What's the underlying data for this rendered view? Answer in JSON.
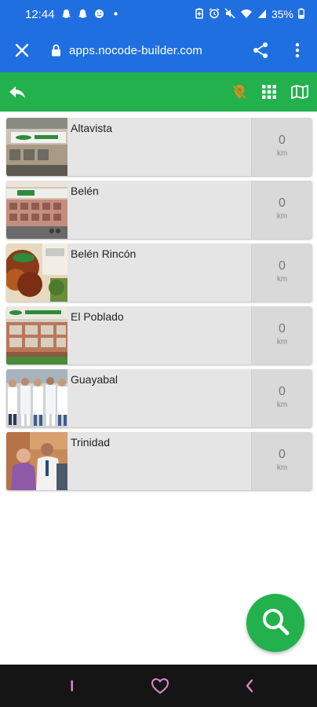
{
  "status_bar": {
    "time": "12:44",
    "battery": "35%",
    "left_icons": [
      "snapchat-icon",
      "snapchat-icon",
      "smiley-icon",
      "dot-icon"
    ],
    "right_icons": [
      "battery-saver-icon",
      "alarm-icon",
      "mute-icon",
      "wifi-icon",
      "signal-icon",
      "battery-icon"
    ]
  },
  "browser": {
    "url": "apps.nocode-builder.com",
    "close_icon": "close-icon",
    "lock_icon": "lock-icon",
    "share_icon": "share-icon",
    "menu_icon": "more-vertical-icon"
  },
  "toolbar": {
    "back_icon": "reply-icon",
    "location_off_icon": "location-off-icon",
    "grid_icon": "grid-icon",
    "map_icon": "map-icon"
  },
  "locations": [
    {
      "name": "Altavista",
      "distance": "0",
      "unit": "km"
    },
    {
      "name": "Belén",
      "distance": "0",
      "unit": "km"
    },
    {
      "name": "Belén Rincón",
      "distance": "0",
      "unit": "km"
    },
    {
      "name": "El Poblado",
      "distance": "0",
      "unit": "km"
    },
    {
      "name": "Guayabal",
      "distance": "0",
      "unit": "km"
    },
    {
      "name": "Trinidad",
      "distance": "0",
      "unit": "km"
    }
  ],
  "fab": {
    "icon": "search-icon"
  },
  "nav": {
    "icons": [
      "recent-apps-icon",
      "home-heart-icon",
      "back-icon"
    ]
  },
  "colors": {
    "primary_blue": "#1f6fe0",
    "toolbar_green": "#22b14c",
    "location_off_orange": "#e08a1e",
    "nav_heart_pink": "#e58bd0"
  }
}
